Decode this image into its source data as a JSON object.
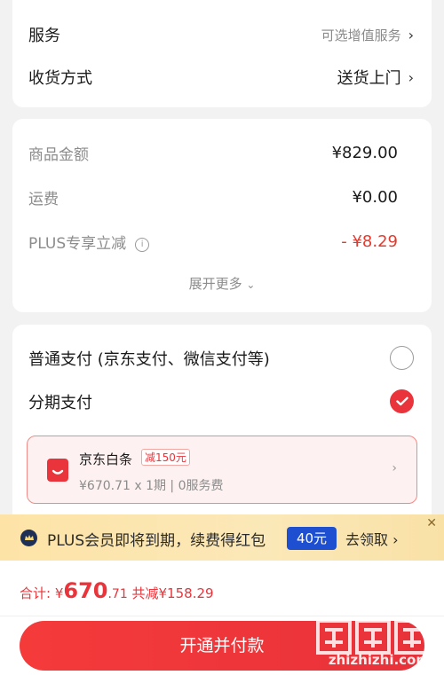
{
  "order": {
    "service": {
      "label": "服务",
      "hint": "可选增值服务"
    },
    "delivery": {
      "label": "收货方式",
      "value": "送货上门"
    }
  },
  "summary": {
    "goods_label": "商品金额",
    "goods_value": "¥829.00",
    "freight_label": "运费",
    "freight_value": "¥0.00",
    "plus_label": "PLUS专享立减",
    "plus_value": "- ¥8.29",
    "expand_label": "展开更多"
  },
  "payment": {
    "normal_label": "普通支付 (京东支付、微信支付等)",
    "installment_label": "分期支付",
    "baitiao": {
      "title": "京东白条",
      "badge": "减150元",
      "desc": "¥670.71 x 1期 | 0服务费"
    }
  },
  "banner": {
    "text": "PLUS会员即将到期，续费得红包",
    "pill": "40元",
    "cta": "去领取"
  },
  "footer": {
    "total_prefix": "合计: ¥",
    "total_int": "670",
    "total_dec": ".71",
    "saved": " 共减¥158.29",
    "button": "开通并付款"
  },
  "watermark": {
    "text": "zhizhizhi.com"
  },
  "colors": {
    "accent": "#e8343a",
    "plus_blue": "#1d4fd0",
    "banner_bg": "#fbe8b8"
  }
}
